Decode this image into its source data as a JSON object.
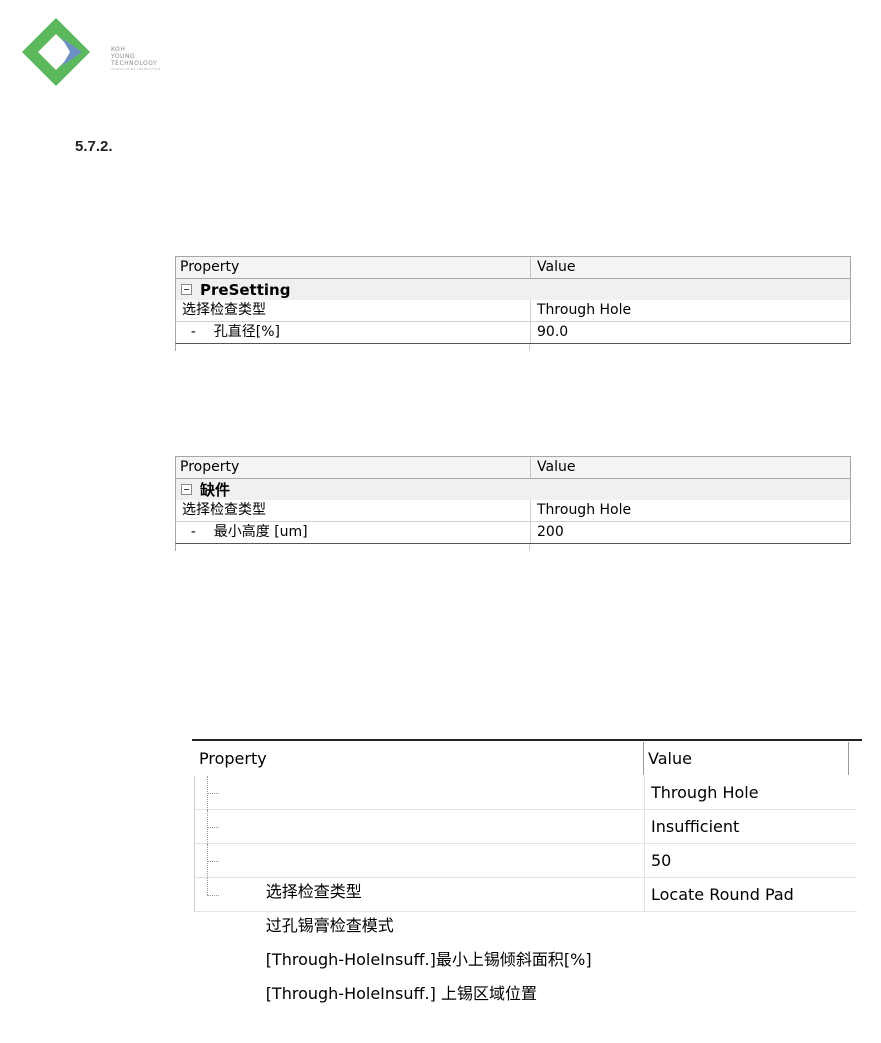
{
  "logo": {
    "lines": [
      "KOH",
      "YOUNG",
      "TECHNOLOGY"
    ],
    "tagline": "INTELLIGENT INSPECTION"
  },
  "section_number": "5.7.2.",
  "grid1": {
    "header": {
      "property": "Property",
      "value": "Value"
    },
    "category": "PreSetting",
    "rows": [
      {
        "property": "选择检查类型",
        "value": "Through Hole"
      },
      {
        "property": "  -    孔直径[%]",
        "value": "90.0"
      }
    ]
  },
  "grid2": {
    "header": {
      "property": "Property",
      "value": "Value"
    },
    "category": "缺件",
    "rows": [
      {
        "property": "选择检查类型",
        "value": "Through Hole"
      },
      {
        "property": "  -    最小高度 [um]",
        "value": "200"
      }
    ]
  },
  "grid3": {
    "header": {
      "property": "Property",
      "value": "Value"
    },
    "rows": [
      {
        "property": "选择检查类型",
        "value": "Through Hole"
      },
      {
        "property": "过孔锡膏检查模式",
        "value": "Insufficient"
      },
      {
        "property": "[Through-HoleInsuff.]最小上锡倾斜面积[%]",
        "value": "50"
      },
      {
        "property": "[Through-HoleInsuff.] 上锡区域位置",
        "value": "Locate Round Pad"
      }
    ]
  },
  "colors": {
    "logo_green": "#5cb85c",
    "logo_blue": "#5b7fb0",
    "grid_border": "#a7a7a7",
    "header_bg": "#f4f4f4"
  }
}
